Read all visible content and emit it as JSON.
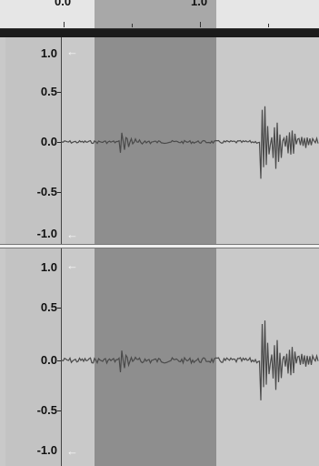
{
  "timeline": {
    "label_left": "0.0",
    "label_right": "1.0"
  },
  "tracks": [
    {
      "scale": {
        "top": "1.0",
        "upper_mid": "0.5",
        "zero": "0.0",
        "lower_mid": "-0.5",
        "bottom": "-1.0"
      },
      "arrow_icon": "←"
    },
    {
      "scale": {
        "top": "1.0",
        "upper_mid": "0.5",
        "zero": "0.0",
        "lower_mid": "-0.5",
        "bottom": "-1.0"
      },
      "arrow_icon": "←"
    }
  ],
  "colors": {
    "waveform": "#4a4a4a",
    "selection": "#8e8e8e",
    "background": "#c9c9c9"
  }
}
